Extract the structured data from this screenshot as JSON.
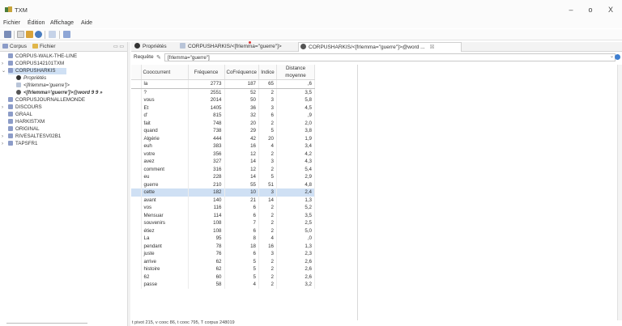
{
  "window": {
    "title": "TXM",
    "controls": {
      "minimize": "–",
      "maximize": "o",
      "close": "X"
    }
  },
  "menu": [
    "Fichier",
    "Édition",
    "Affichage",
    "Aide"
  ],
  "left_panel": {
    "tabs": [
      {
        "label": "Corpus",
        "icon": "corpus-icon"
      },
      {
        "label": "Fichier",
        "icon": "folder-icon"
      }
    ],
    "controls": "▭ ▭",
    "tree": [
      {
        "label": "CORPUS-WALK-THE-LINE",
        "expanded": false,
        "has_arrow": false
      },
      {
        "label": "CORPUS142101TXM",
        "expanded": false,
        "has_arrow": true
      },
      {
        "label": "CORPUSHARKIS",
        "expanded": true,
        "has_arrow": true,
        "selected": true
      },
      {
        "label": "Propriétés",
        "child": true,
        "italic": true
      },
      {
        "label": "<[frlemma='guerre']>",
        "child": true,
        "italic": true
      },
      {
        "label": "<[frlemma='guerre']>@word 9 9 »",
        "child": true,
        "italic": true,
        "bold": true
      },
      {
        "label": "CORPUSJOURNALLEMONDE",
        "expanded": false,
        "has_arrow": false
      },
      {
        "label": "DISCOURS",
        "expanded": false,
        "has_arrow": true
      },
      {
        "label": "GRAAL",
        "expanded": false,
        "has_arrow": false
      },
      {
        "label": "HARKISTXM",
        "expanded": false,
        "has_arrow": false
      },
      {
        "label": "ORIGINAL",
        "expanded": false,
        "has_arrow": false
      },
      {
        "label": "RIVESALTESV02B1",
        "expanded": false,
        "has_arrow": true
      },
      {
        "label": "TAPSFR1",
        "expanded": false,
        "has_arrow": true
      }
    ]
  },
  "editor_tabs": [
    {
      "label": "Propriétés",
      "active": false
    },
    {
      "label": "CORPUSHARKIS/<[frlemma=\"guerre\"]>",
      "active": false
    },
    {
      "label": "CORPUSHARKIS/<[frlemma=\"guerre\"]>@word ...",
      "active": true,
      "close": "☒"
    }
  ],
  "query": {
    "label": "Requête",
    "value": "[frlemma=\"guerre\"]"
  },
  "table": {
    "columns": [
      "Cooccurrent",
      "Fréquence",
      "CoFréquence",
      "Indice",
      "Distance moyenne"
    ],
    "rows": [
      [
        "la",
        "2773",
        "187",
        "65",
        ",6"
      ],
      [
        "?",
        "2551",
        "52",
        "2",
        "3,5"
      ],
      [
        "vous",
        "2014",
        "50",
        "3",
        "5,8"
      ],
      [
        "Et",
        "1405",
        "36",
        "3",
        "4,5"
      ],
      [
        "d'",
        "815",
        "32",
        "6",
        ",9"
      ],
      [
        "fait",
        "748",
        "20",
        "2",
        "2,0"
      ],
      [
        "quand",
        "738",
        "29",
        "5",
        "3,8"
      ],
      [
        "Algérie",
        "444",
        "42",
        "20",
        "1,9"
      ],
      [
        "euh",
        "383",
        "16",
        "4",
        "3,4"
      ],
      [
        "votre",
        "356",
        "12",
        "2",
        "4,2"
      ],
      [
        "avez",
        "327",
        "14",
        "3",
        "4,3"
      ],
      [
        "comment",
        "316",
        "12",
        "2",
        "5,4"
      ],
      [
        "eu",
        "228",
        "14",
        "5",
        "2,9"
      ],
      [
        "guerre",
        "210",
        "55",
        "51",
        "4,8"
      ],
      [
        "cette",
        "182",
        "10",
        "3",
        "2,4"
      ],
      [
        "avant",
        "140",
        "21",
        "14",
        "1,3"
      ],
      [
        "vos",
        "116",
        "6",
        "2",
        "5,2"
      ],
      [
        "Mensuar",
        "114",
        "6",
        "2",
        "3,5"
      ],
      [
        "souvenirs",
        "108",
        "7",
        "2",
        "2,5"
      ],
      [
        "étiez",
        "108",
        "6",
        "2",
        "5,0"
      ],
      [
        "La",
        "95",
        "8",
        "4",
        ",0"
      ],
      [
        "pendant",
        "78",
        "18",
        "16",
        "1,3"
      ],
      [
        "juste",
        "76",
        "6",
        "3",
        "2,3"
      ],
      [
        "arrive",
        "62",
        "5",
        "2",
        "2,6"
      ],
      [
        "histoire",
        "62",
        "5",
        "2",
        "2,6"
      ],
      [
        "62",
        "60",
        "5",
        "2",
        "2,6"
      ],
      [
        "passe",
        "58",
        "4",
        "2",
        "3,2"
      ]
    ],
    "selected_row": 14,
    "outlined_row": 0
  },
  "status_bar": "t pivot 215, v cooc 86, t cooc 795, T corpus 248019",
  "colors": {
    "selection": "#cfe0f4",
    "accent": "#3f7fd0",
    "tree_icon": "#8c9cc8"
  }
}
